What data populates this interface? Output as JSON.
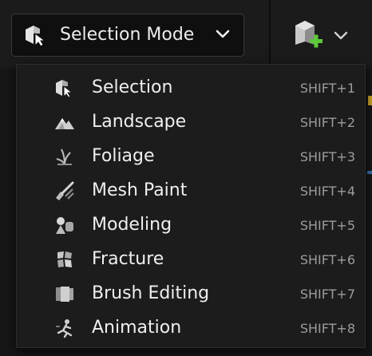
{
  "toolbar": {
    "mode_button": {
      "label": "Selection Mode",
      "icon": "selection-mode-icon",
      "chevron_icon": "chevron-down-icon"
    },
    "add_actor_button": {
      "icon": "add-actor-icon",
      "chevron_icon": "chevron-down-icon"
    }
  },
  "mode_menu": {
    "items": [
      {
        "label": "Selection",
        "shortcut": "SHIFT+1",
        "icon": "selection-icon"
      },
      {
        "label": "Landscape",
        "shortcut": "SHIFT+2",
        "icon": "landscape-icon"
      },
      {
        "label": "Foliage",
        "shortcut": "SHIFT+3",
        "icon": "foliage-icon"
      },
      {
        "label": "Mesh Paint",
        "shortcut": "SHIFT+4",
        "icon": "mesh-paint-icon"
      },
      {
        "label": "Modeling",
        "shortcut": "SHIFT+5",
        "icon": "modeling-icon"
      },
      {
        "label": "Fracture",
        "shortcut": "SHIFT+6",
        "icon": "fracture-icon"
      },
      {
        "label": "Brush Editing",
        "shortcut": "SHIFT+7",
        "icon": "brush-editing-icon"
      },
      {
        "label": "Animation",
        "shortcut": "SHIFT+8",
        "icon": "animation-icon"
      }
    ]
  },
  "colors": {
    "add_icon_green": "#5cc93a",
    "menu_background": "#1c1c1c",
    "shortcut_text": "#9c9c9c"
  }
}
